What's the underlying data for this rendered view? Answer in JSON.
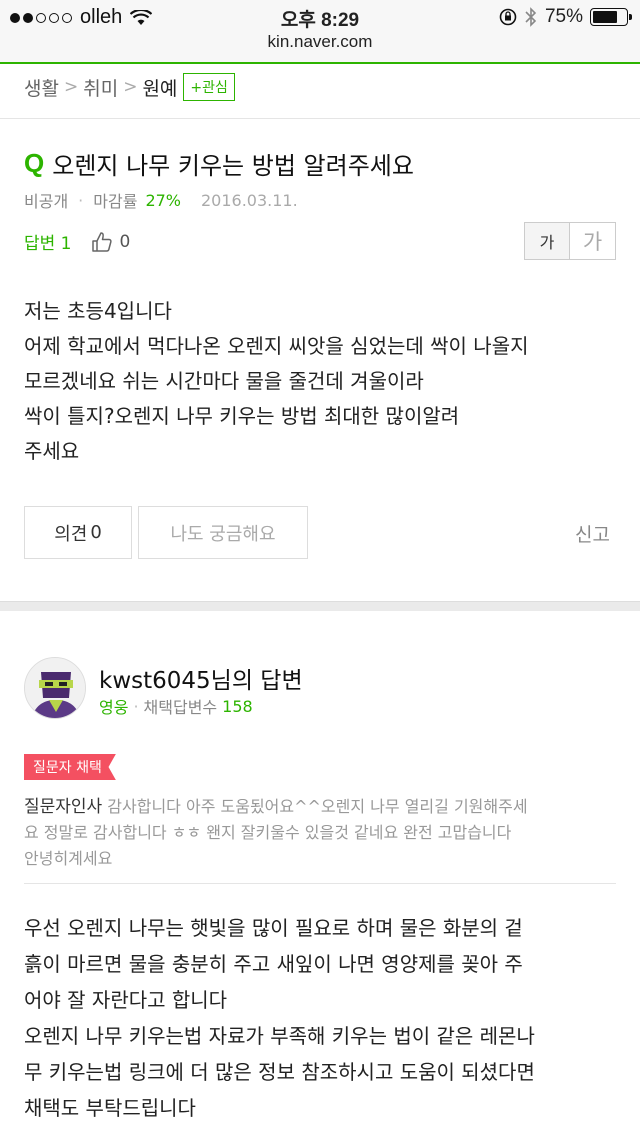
{
  "status_bar": {
    "carrier": "olleh",
    "time": "오후 8:29",
    "url": "kin.naver.com",
    "battery": "75%",
    "battery_level": 0.75,
    "signal_bars": 2
  },
  "breadcrumb": {
    "items": [
      "생활",
      "취미",
      "원예"
    ],
    "separator": ">",
    "follow_label": "+관심"
  },
  "question": {
    "mark": "Q",
    "title": "오렌지 나무 키우는 방법 알려주세요",
    "author": "비공개",
    "deadline_label": "마감률",
    "deadline_rate": "27%",
    "date": "2016.03.11.",
    "answers_label": "답변 1",
    "likes": "0",
    "font_small": "가",
    "font_large": "가",
    "body": [
      "저는 초등4입니다",
      "어제 학교에서 먹다나온 오렌지 씨앗을 심었는데 싹이 나올지",
      "모르겠네요 쉬는 시간마다 물을 줄건데 겨울이라",
      "싹이 틀지?오렌지 나무 키우는 방법 최대한 많이알려",
      "주세요"
    ],
    "opinion_label": "의견",
    "opinion_count": "0",
    "curious_label": "나도 궁금해요",
    "report_label": "신고"
  },
  "answer": {
    "title": "kwst6045님의 답변",
    "rank": "영웅",
    "chosen_count_label": "채택답변수",
    "chosen_count": "158",
    "badge": "질문자 채택",
    "thanks_label": "질문자인사",
    "thanks_lines": [
      "감사합니다 아주 도움됬어요^^오렌지 나무 열리길 기원해주세",
      "요 정말로 감사합니다 ㅎㅎ 왠지 잘키울수 있을것 같네요 완전 고맙습니다",
      "안녕히계세요"
    ],
    "body": [
      "우선 오렌지 나무는 햇빛을 많이 필요로 하며 물은 화분의 겉",
      "흙이 마르면 물을 충분히 주고 새잎이 나면 영양제를 꽂아 주",
      "어야 잘 자란다고 합니다",
      "오렌지 나무 키우는법 자료가 부족해 키우는 법이 같은 레몬나",
      "무 키우는법 링크에 더 많은 정보 참조하시고 도움이 되셨다면",
      "채택도 부탁드립니다"
    ]
  },
  "colors": {
    "accent": "#2db400",
    "badge": "#f45061"
  }
}
